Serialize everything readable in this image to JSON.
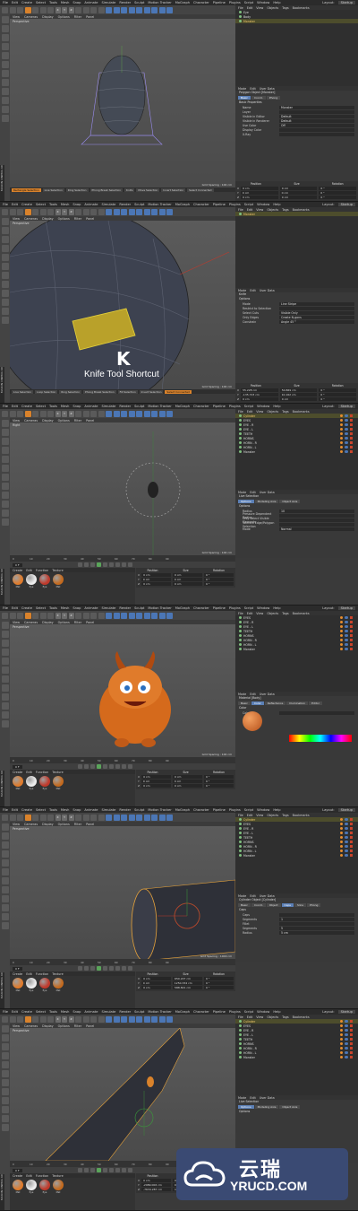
{
  "menus": [
    "File",
    "Edit",
    "Create",
    "Select",
    "Tools",
    "Mesh",
    "Snap",
    "Animate",
    "Simulate",
    "Render",
    "Sculpt",
    "Motion Tracker",
    "MoGraph",
    "Character",
    "Pipeline",
    "Plugins",
    "Script",
    "Window",
    "Help"
  ],
  "layout_label": "Layout:",
  "layout_value": "Startup",
  "viewport_menu": [
    "View",
    "Cameras",
    "Display",
    "Options",
    "Filter",
    "Panel"
  ],
  "right_menu": [
    "File",
    "Edit",
    "View",
    "Objects",
    "Tags",
    "Bookmarks"
  ],
  "attr_menu": [
    "Mode",
    "Edit",
    "User Data"
  ],
  "xyz": [
    "X",
    "Y",
    "Z"
  ],
  "coord_headers": [
    "Position",
    "Size",
    "Rotation"
  ],
  "coord_axes": [
    "X",
    "Y",
    "Z"
  ],
  "frames": [
    {
      "viewport_label": "Perspective",
      "grid_spacing": "Grid Spacing : 100 cm",
      "objects": [
        {
          "name": "Eye",
          "sel": false
        },
        {
          "name": "Body",
          "sel": false
        },
        {
          "name": "Monster",
          "sel": true
        }
      ],
      "attr_title": "Polygon Object [Monster]",
      "attr_tabs": [
        {
          "label": "Basic",
          "on": true
        },
        {
          "label": "Coord.",
          "on": false
        },
        {
          "label": "Phong",
          "on": false
        }
      ],
      "attr_section": "Basic Properties",
      "attr_fields": [
        {
          "label": "Name",
          "value": "Monster"
        },
        {
          "label": "Layer",
          "value": ""
        },
        {
          "label": "Visible in Editor",
          "value": "Default"
        },
        {
          "label": "Visible in Renderer",
          "value": "Default"
        },
        {
          "label": "Use Color",
          "value": "Off"
        },
        {
          "label": "Display Color",
          "value": ""
        },
        {
          "label": "X-Ray",
          "value": ""
        }
      ],
      "status_items": [
        {
          "label": "Rectangle Selection",
          "on": true
        },
        {
          "label": "Live Selection",
          "on": false
        },
        {
          "label": "Ring Selection",
          "on": false
        },
        {
          "label": "Phong Break Selection",
          "on": false
        },
        {
          "label": "Knife",
          "on": false
        },
        {
          "label": "Move Selection",
          "on": false
        },
        {
          "label": "Invert Selection",
          "on": false
        },
        {
          "label": "Select Connected",
          "on": false
        }
      ],
      "coords": [
        [
          "0 cm",
          "0 cm",
          "0 °"
        ],
        [
          "0 cm",
          "0 cm",
          "0 °"
        ],
        [
          "0 cm",
          "0 cm",
          "0 °"
        ]
      ]
    },
    {
      "viewport_label": "Perspective",
      "grid_spacing": "Grid Spacing : 100 cm",
      "objects": [
        {
          "name": "Monster",
          "sel": true
        }
      ],
      "attr_title": "Knife",
      "attr_tabs": [],
      "attr_section": "Options",
      "attr_fields": [
        {
          "label": "Mode",
          "value": "Line   Stripe"
        },
        {
          "label": "Restrict to Selection",
          "value": ""
        },
        {
          "label": "Select Cuts",
          "value": "Visible Only"
        },
        {
          "label": "Only Edges",
          "value": "Create N-gons"
        },
        {
          "label": "Constrain",
          "value": "Angle 45 °"
        }
      ],
      "knife_letter": "K",
      "knife_title": "Knife Tool Shortcut",
      "status_items": [
        {
          "label": "Live Selection",
          "on": false
        },
        {
          "label": "Loop Selection",
          "on": false
        },
        {
          "label": "Ring Selection",
          "on": false
        },
        {
          "label": "Phong Break Selection",
          "on": false
        },
        {
          "label": "Fill Selection",
          "on": false
        },
        {
          "label": "Invert Selection",
          "on": false
        },
        {
          "label": "Select Connected",
          "on": true
        }
      ],
      "coords": [
        [
          "55.228 cm",
          "50.869 cm",
          "0 °"
        ],
        [
          "-135.723 cm",
          "10.162 cm",
          "0 °"
        ],
        [
          "0 cm",
          "0 cm",
          "0 °"
        ]
      ]
    },
    {
      "viewport_label": "Right",
      "grid_spacing": "Grid Spacing : 100 cm",
      "objects": [
        {
          "name": "Cylinder",
          "sel": true
        },
        {
          "name": "EYES",
          "sel": false
        },
        {
          "name": "EYE - R",
          "sel": false
        },
        {
          "name": "EYE - L",
          "sel": false
        },
        {
          "name": "TEETH",
          "sel": false
        },
        {
          "name": "HORNS",
          "sel": false
        },
        {
          "name": "HORN - R",
          "sel": false
        },
        {
          "name": "HORN - L",
          "sel": false
        },
        {
          "name": "Monster",
          "sel": false
        }
      ],
      "attr_title": "Live Selection",
      "attr_tabs": [
        {
          "label": "Options",
          "on": true
        },
        {
          "label": "Modeling Axis",
          "on": false
        },
        {
          "label": "Object Axis",
          "on": false
        }
      ],
      "attr_section": "Options",
      "attr_fields": [
        {
          "label": "Radius",
          "value": "10"
        },
        {
          "label": "Pressure Dependent Radius",
          "value": ""
        },
        {
          "label": "Only Select Visible Elements",
          "value": ""
        },
        {
          "label": "Tolerant Edge/Polygon Selection",
          "value": ""
        },
        {
          "label": "Mode",
          "value": "Normal"
        }
      ],
      "timeline_ticks": [
        "0",
        "10",
        "20",
        "30",
        "40",
        "50",
        "60",
        "70",
        "80",
        "90"
      ],
      "frame_field": "0 F",
      "materials": [
        {
          "label": "Mat",
          "color": "#e07b2b"
        },
        {
          "label": "Eye",
          "color": "#eeeeee"
        },
        {
          "label": "Eye",
          "color": "#c0392b"
        },
        {
          "label": "Mat",
          "color": "#c46a1e"
        }
      ],
      "mat_menu": [
        "Create",
        "Edit",
        "Function",
        "Texture"
      ],
      "coords": [
        [
          "0 cm",
          "0 cm",
          "0 °"
        ],
        [
          "0 cm",
          "0 cm",
          "0 °"
        ],
        [
          "0 cm",
          "0 cm",
          "0 °"
        ]
      ]
    },
    {
      "viewport_label": "Perspective",
      "grid_spacing": "Grid Spacing : 100 cm",
      "objects": [
        {
          "name": "EYES",
          "sel": false
        },
        {
          "name": "EYE - R",
          "sel": false
        },
        {
          "name": "EYE - L",
          "sel": false
        },
        {
          "name": "TEETH",
          "sel": false
        },
        {
          "name": "HORNS",
          "sel": false
        },
        {
          "name": "HORN - R",
          "sel": false
        },
        {
          "name": "HORN - L",
          "sel": false
        },
        {
          "name": "Monster",
          "sel": false
        }
      ],
      "attr_title": "Material [Body]",
      "attr_tabs": [
        {
          "label": "Basic",
          "on": false
        },
        {
          "label": "Color",
          "on": true
        },
        {
          "label": "Reflectance",
          "on": false
        },
        {
          "label": "Illumination",
          "on": false
        },
        {
          "label": "Editor",
          "on": false
        }
      ],
      "attr_section": "Color",
      "attr_fields": [
        {
          "label": "Color",
          "value": ""
        }
      ],
      "timeline_ticks": [
        "0",
        "10",
        "20",
        "30",
        "40",
        "50",
        "60",
        "70",
        "80",
        "90"
      ],
      "frame_field": "0 F",
      "materials": [
        {
          "label": "Mat",
          "color": "#e07b2b"
        },
        {
          "label": "Eye",
          "color": "#eeeeee"
        },
        {
          "label": "Eye",
          "color": "#c0392b"
        },
        {
          "label": "Mat",
          "color": "#c46a1e"
        }
      ],
      "mat_menu": [
        "Create",
        "Edit",
        "Function",
        "Texture"
      ],
      "coords": [
        [
          "0 cm",
          "0 cm",
          "0 °"
        ],
        [
          "0 cm",
          "0 cm",
          "0 °"
        ],
        [
          "0 cm",
          "0 cm",
          "0 °"
        ]
      ]
    },
    {
      "viewport_label": "Perspective",
      "grid_spacing": "Grid Spacing : 1000 cm",
      "objects": [
        {
          "name": "Cylinder",
          "sel": true
        },
        {
          "name": "EYES",
          "sel": false
        },
        {
          "name": "EYE - R",
          "sel": false
        },
        {
          "name": "EYE - L",
          "sel": false
        },
        {
          "name": "TEETH",
          "sel": false
        },
        {
          "name": "HORNS",
          "sel": false
        },
        {
          "name": "HORN - R",
          "sel": false
        },
        {
          "name": "HORN - L",
          "sel": false
        },
        {
          "name": "Monster",
          "sel": false
        }
      ],
      "attr_title": "Cylinder Object [Cylinder]",
      "attr_tabs": [
        {
          "label": "Basic",
          "on": false
        },
        {
          "label": "Coord.",
          "on": false
        },
        {
          "label": "Object",
          "on": false
        },
        {
          "label": "Caps",
          "on": true
        },
        {
          "label": "Slice",
          "on": false
        },
        {
          "label": "Phong",
          "on": false
        }
      ],
      "attr_section": "Caps",
      "attr_fields": [
        {
          "label": "Caps",
          "value": ""
        },
        {
          "label": "Segments",
          "value": "1"
        },
        {
          "label": "Fillet",
          "value": ""
        },
        {
          "label": "Segments",
          "value": "5"
        },
        {
          "label": "Radius",
          "value": "5 cm"
        }
      ],
      "timeline_ticks": [
        "0",
        "10",
        "20",
        "30",
        "40",
        "50",
        "60",
        "70",
        "80",
        "90"
      ],
      "frame_field": "0 F",
      "materials": [
        {
          "label": "Mat",
          "color": "#e07b2b"
        },
        {
          "label": "Eye",
          "color": "#eeeeee"
        },
        {
          "label": "Eye",
          "color": "#c0392b"
        },
        {
          "label": "Mat",
          "color": "#c46a1e"
        }
      ],
      "mat_menu": [
        "Create",
        "Edit",
        "Function",
        "Texture"
      ],
      "coords": [
        [
          "0 cm",
          "650.227 cm",
          "0 °"
        ],
        [
          "0 cm",
          "1250.334 cm",
          "0 °"
        ],
        [
          "0 cm",
          "588.821 cm",
          "0 °"
        ]
      ]
    },
    {
      "viewport_label": "Perspective",
      "grid_spacing": "Grid Spacing : 1000 cm",
      "objects": [
        {
          "name": "Cylinder",
          "sel": true
        },
        {
          "name": "EYES",
          "sel": false
        },
        {
          "name": "EYE - R",
          "sel": false
        },
        {
          "name": "EYE - L",
          "sel": false
        },
        {
          "name": "TEETH",
          "sel": false
        },
        {
          "name": "HORNS",
          "sel": false
        },
        {
          "name": "HORN - R",
          "sel": false
        },
        {
          "name": "HORN - L",
          "sel": false
        },
        {
          "name": "Monster",
          "sel": false
        }
      ],
      "attr_title": "Live Selection",
      "attr_tabs": [
        {
          "label": "Options",
          "on": true
        },
        {
          "label": "Modeling Axis",
          "on": false
        },
        {
          "label": "Object Axis",
          "on": false
        }
      ],
      "attr_section": "Options",
      "attr_fields": [],
      "timeline_ticks": [
        "0",
        "10",
        "20",
        "30",
        "40",
        "50",
        "60",
        "70",
        "80",
        "90"
      ],
      "frame_field": "0 F",
      "materials": [
        {
          "label": "Mat",
          "color": "#e07b2b"
        },
        {
          "label": "Eye",
          "color": "#eeeeee"
        },
        {
          "label": "Eye",
          "color": "#c0392b"
        },
        {
          "label": "Mat",
          "color": "#c46a1e"
        }
      ],
      "mat_menu": [
        "Create",
        "Edit",
        "Function",
        "Texture"
      ],
      "coords": [
        [
          "0 cm",
          "0 cm",
          "0 °"
        ],
        [
          "-2989.006 cm",
          "0 cm",
          "0 °"
        ],
        [
          "-7634.287 cm",
          "10640.406 cm",
          "0 °"
        ]
      ]
    }
  ],
  "watermark": {
    "cn": "云瑞",
    "en": "YRUCD.COM"
  },
  "side_label": "MAXON CINEMA 4D"
}
